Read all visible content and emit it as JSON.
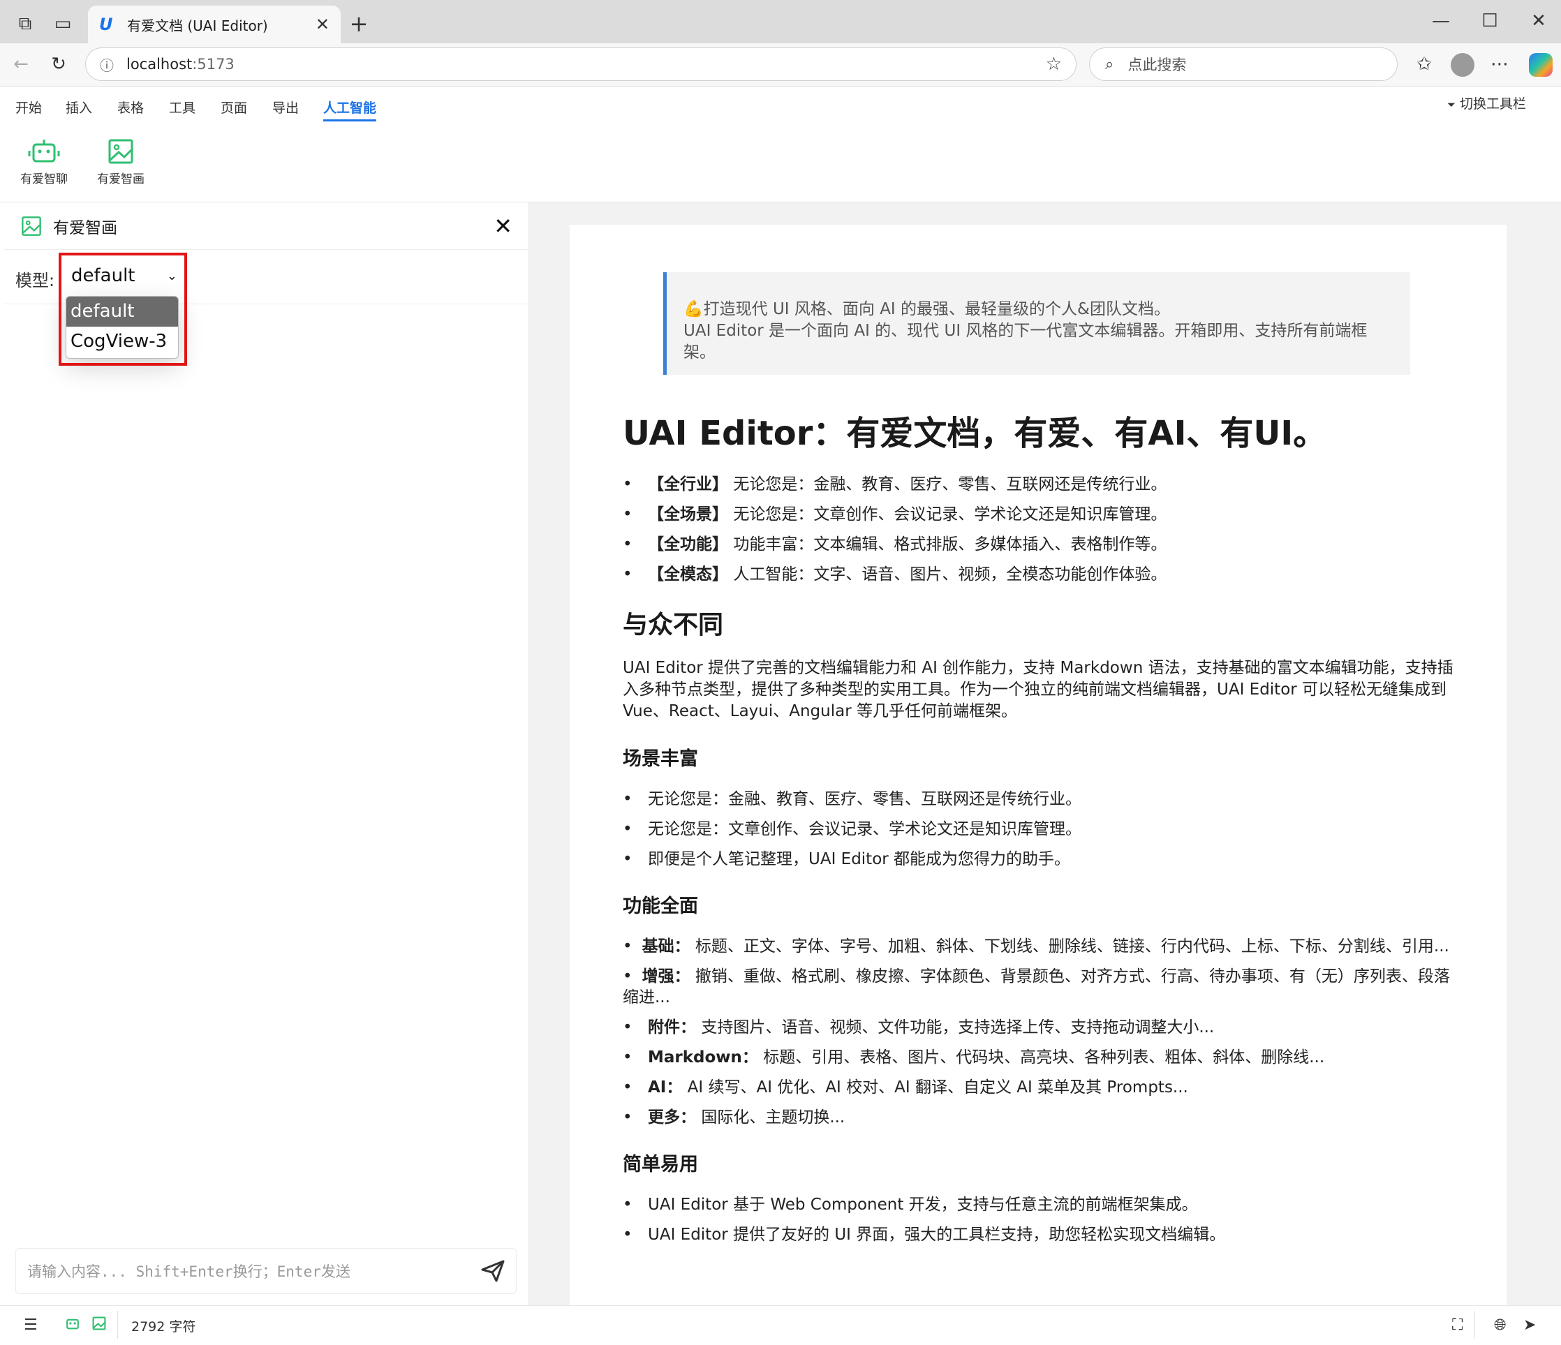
{
  "browser": {
    "tab_title": "有爱文档 (UAI Editor)",
    "url_host": "localhost",
    "url_port": ":5173",
    "search_placeholder": "点此搜索"
  },
  "menu": {
    "tabs": [
      "开始",
      "插入",
      "表格",
      "工具",
      "页面",
      "导出",
      "人工智能"
    ],
    "active_tab": "人工智能",
    "switch_toolbar": "切换工具栏",
    "tools": [
      "有爱智聊",
      "有爱智画"
    ]
  },
  "panel": {
    "title": "有爱智画",
    "model_label": "模型:",
    "model_selected": "default",
    "model_options": [
      "default",
      "CogView-3"
    ],
    "chat_placeholder": "请输入内容... Shift+Enter换行；Enter发送"
  },
  "doc": {
    "quote_line1": "💪打造现代 UI 风格、面向 AI 的最强、最轻量级的个人&团队文档。",
    "quote_line2": "UAI Editor 是一个面向 AI 的、现代 UI 风格的下一代富文本编辑器。开箱即用、支持所有前端框架。",
    "h1": "UAI Editor：有爱文档，有爱、有AI、有UI。",
    "intro_items": [
      {
        "tag": "【全行业】",
        "text": "无论您是：金融、教育、医疗、零售、互联网还是传统行业。"
      },
      {
        "tag": "【全场景】",
        "text": "无论您是：文章创作、会议记录、学术论文还是知识库管理。"
      },
      {
        "tag": "【全功能】",
        "text": "功能丰富：文本编辑、格式排版、多媒体插入、表格制作等。"
      },
      {
        "tag": "【全模态】",
        "text": "人工智能：文字、语音、图片、视频，全模态功能创作体验。"
      }
    ],
    "h2": "与众不同",
    "para": "UAI Editor 提供了完善的文档编辑能力和 AI 创作能力，支持 Markdown 语法，支持基础的富文本编辑功能，支持插入多种节点类型，提供了多种类型的实用工具。作为一个独立的纯前端文档编辑器，UAI Editor 可以轻松无缝集成到 Vue、React、Layui、Angular 等几乎任何前端框架。",
    "h3_scene": "场景丰富",
    "scene_items": [
      "无论您是：金融、教育、医疗、零售、互联网还是传统行业。",
      "无论您是：文章创作、会议记录、学术论文还是知识库管理。",
      "即便是个人笔记整理，UAI Editor 都能成为您得力的助手。"
    ],
    "h3_func": "功能全面",
    "func_items": [
      {
        "tag": "基础：",
        "text": "标题、正文、字体、字号、加粗、斜体、下划线、删除线、链接、行内代码、上标、下标、分割线、引用..."
      },
      {
        "tag": "增强：",
        "text": "撤销、重做、格式刷、橡皮擦、字体颜色、背景颜色、对齐方式、行高、待办事项、有（无）序列表、段落缩进..."
      },
      {
        "tag": "附件：",
        "text": "支持图片、语音、视频、文件功能，支持选择上传、支持拖动调整大小..."
      },
      {
        "tag": "Markdown：",
        "text": "标题、引用、表格、图片、代码块、高亮块、各种列表、粗体、斜体、删除线..."
      },
      {
        "tag": "AI：",
        "text": "AI 续写、AI 优化、AI 校对、AI 翻译、自定义 AI 菜单及其 Prompts..."
      },
      {
        "tag": "更多：",
        "text": "国际化、主题切换..."
      }
    ],
    "h3_easy": "简单易用",
    "easy_items": [
      "UAI Editor 基于 Web Component 开发，支持与任意主流的前端框架集成。",
      "UAI Editor 提供了友好的 UI 界面，强大的工具栏支持，助您轻松实现文档编辑。"
    ]
  },
  "status": {
    "char_count": "2792 字符"
  },
  "colors": {
    "accent": "#1a73e8",
    "green_icon": "#2fbf71",
    "highlight_red": "#e01616"
  }
}
